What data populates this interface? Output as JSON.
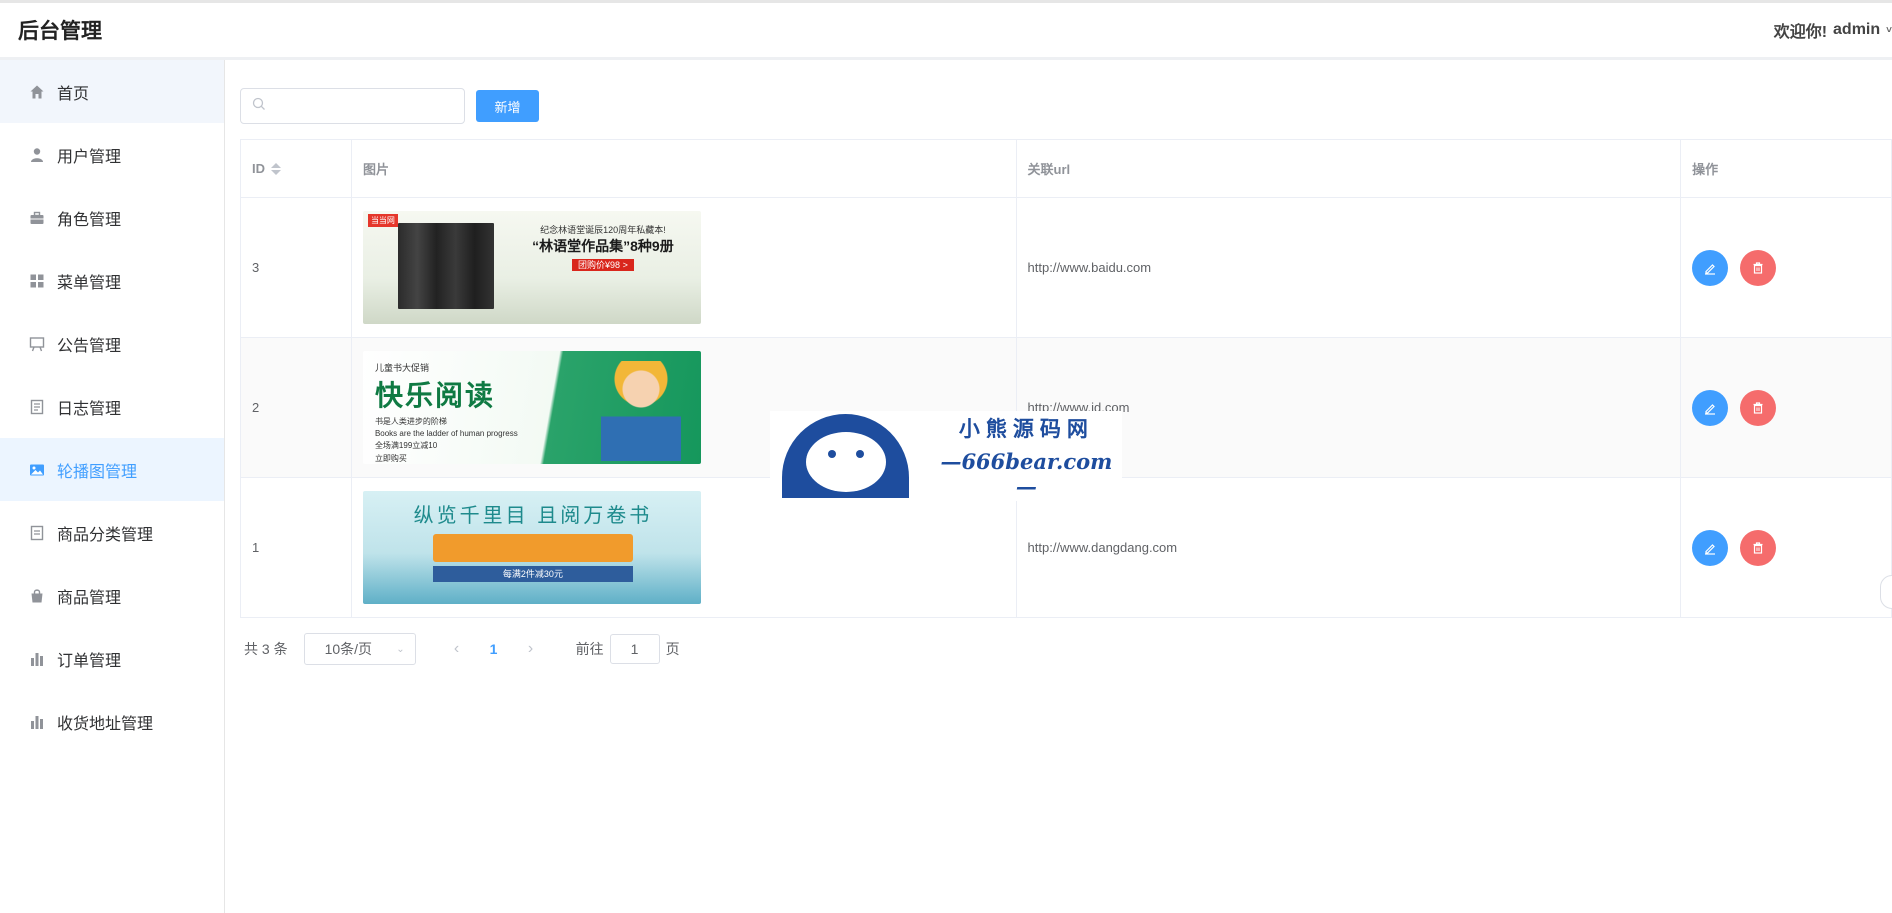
{
  "header": {
    "app_title": "后台管理",
    "welcome": "欢迎你!",
    "username": "admin"
  },
  "sidebar": {
    "items": [
      {
        "label": "首页",
        "icon": "home-icon"
      },
      {
        "label": "用户管理",
        "icon": "user-icon"
      },
      {
        "label": "角色管理",
        "icon": "briefcase-icon"
      },
      {
        "label": "菜单管理",
        "icon": "grid-icon"
      },
      {
        "label": "公告管理",
        "icon": "easel-icon"
      },
      {
        "label": "日志管理",
        "icon": "notebook-icon"
      },
      {
        "label": "轮播图管理",
        "icon": "picture-icon",
        "active": true
      },
      {
        "label": "商品分类管理",
        "icon": "document-icon"
      },
      {
        "label": "商品管理",
        "icon": "shopping-bag-icon"
      },
      {
        "label": "订单管理",
        "icon": "bar-chart-icon"
      },
      {
        "label": "收货地址管理",
        "icon": "bar-chart-icon"
      }
    ]
  },
  "toolbar": {
    "search_placeholder": "",
    "add_label": "新增"
  },
  "table": {
    "columns": [
      "ID",
      "图片",
      "关联url",
      "操作"
    ],
    "rows": [
      {
        "id": "3",
        "url": "http://www.baidu.com",
        "banner": {
          "tag": "当当网",
          "line1": "纪念林语堂诞辰120周年私藏本!",
          "line2": "“林语堂作品集”8种9册",
          "price": "团购价¥98 >"
        }
      },
      {
        "id": "2",
        "url": "http://www.jd.com",
        "banner": {
          "line1": "儿童书大促销",
          "line2": "快乐阅读",
          "line3": "书是人类进步的阶梯",
          "line4": "Books are the ladder of human progress",
          "line5": "全场满199立减10",
          "line6": "立即购买"
        }
      },
      {
        "id": "1",
        "url": "http://www.dangdang.com",
        "banner": {
          "line1": "纵览千里目 且阅万卷书",
          "line2": "每满2件减30元"
        }
      }
    ]
  },
  "pagination": {
    "total": "共 3 条",
    "page_size": "10条/页",
    "current_page": "1",
    "goto_label": "前往",
    "goto_value": "1",
    "page_suffix": "页"
  },
  "watermark": {
    "line1": "小熊源码网",
    "line2": "—666bear.com—"
  },
  "colors": {
    "accent": "#409eff",
    "danger": "#f56c6c",
    "active_bg": "#ecf5ff"
  }
}
